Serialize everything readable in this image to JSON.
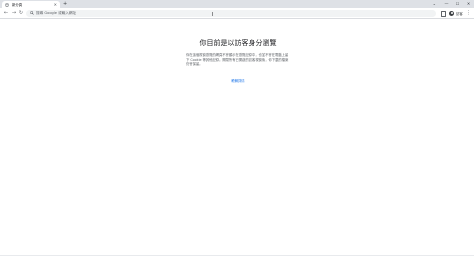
{
  "tab": {
    "title": "新分頁",
    "close_icon": "close-icon",
    "favicon_icon": "incognito-icon"
  },
  "new_tab_icon": "plus-icon",
  "window_controls": {
    "tab_search_icon": "chevron-down-icon",
    "minimize_icon": "minimize-icon",
    "maximize_icon": "maximize-icon",
    "close_icon": "close-icon"
  },
  "toolbar": {
    "back_icon": "back-arrow-icon",
    "forward_icon": "forward-arrow-icon",
    "reload_icon": "reload-icon",
    "omnibox_placeholder": "搜尋 Google 或輸入網址",
    "profile_label": "訪客"
  },
  "content": {
    "title": "你目前是以訪客身分瀏覽",
    "body": "你在這個視窗瀏覽的網頁不會顯示在瀏覽記錄中，也並不會在電腦上留下 Cookie 等其他記錄。關閉所有已開啟的訪客視窗後，你下載的檔案仍會保留。",
    "learn_more": "瞭解詳情"
  },
  "colors": {
    "tabstrip": "#dee1e6",
    "omnibox": "#f1f3f4",
    "link": "#1a73e8",
    "text": "#202124",
    "muted": "#5f6368"
  }
}
